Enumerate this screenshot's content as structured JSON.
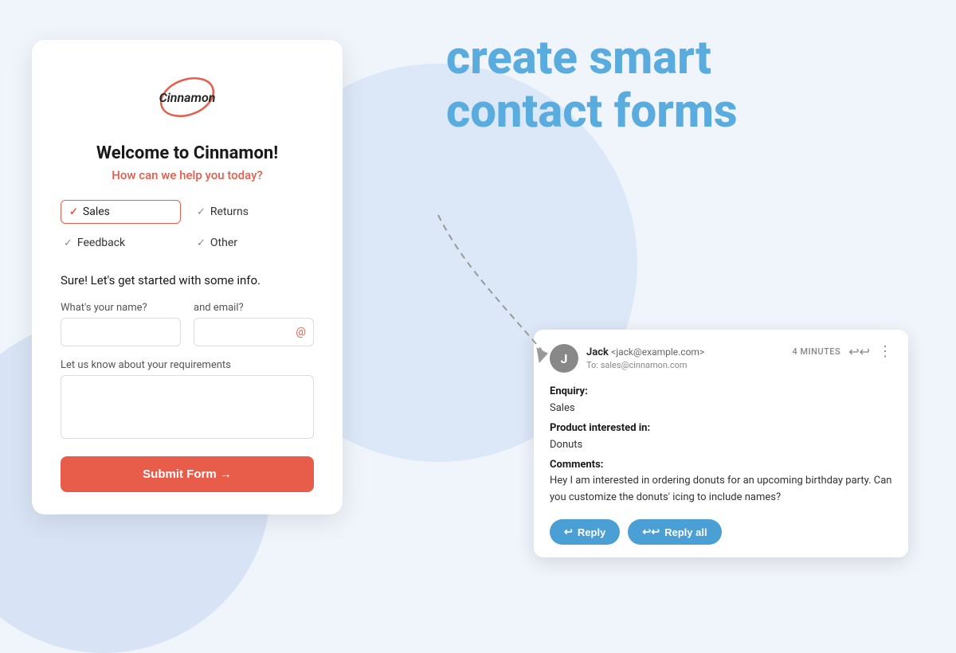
{
  "page": {
    "background_color": "#f0f4fb"
  },
  "headline": {
    "line1": "create smart",
    "line2": "contact forms"
  },
  "form_card": {
    "logo_text": "Cinnamon",
    "welcome_title": "Welcome to Cinnamon!",
    "welcome_subtitle": "How can we help you today?",
    "options": [
      {
        "id": "sales",
        "label": "Sales",
        "selected": true
      },
      {
        "id": "returns",
        "label": "Returns",
        "selected": false
      },
      {
        "id": "feedback",
        "label": "Feedback",
        "selected": false
      },
      {
        "id": "other",
        "label": "Other",
        "selected": false
      }
    ],
    "info_text": "Sure! Let's get started with some info.",
    "name_label": "What's your name?",
    "email_label": "and email?",
    "requirements_label": "Let us know about your requirements",
    "submit_label": "Submit Form →"
  },
  "email_card": {
    "sender_initial": "J",
    "sender_name": "Jack",
    "sender_email": "jack@example.com",
    "to_label": "To:",
    "to_address": "sales@cinnamon.com",
    "time": "4 MINUTES",
    "enquiry_label": "Enquiry:",
    "enquiry_value": "Sales",
    "product_label": "Product interested in:",
    "product_value": "Donuts",
    "comments_label": "Comments:",
    "comments_value": "Hey I am interested in ordering donuts for an upcoming birthday party. Can you customize the donuts' icing to include names?",
    "reply_label": "Reply",
    "reply_all_label": "Reply all"
  }
}
